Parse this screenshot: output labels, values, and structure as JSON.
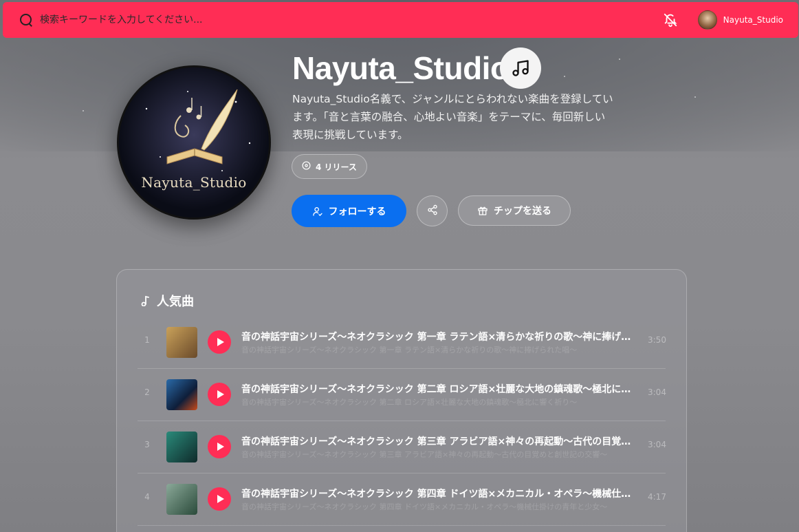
{
  "search": {
    "placeholder": "検索キーワードを入力してください..."
  },
  "user": {
    "name": "Nayuta_Studio"
  },
  "artist": {
    "name": "Nayuta_Studio",
    "avatar_caption": "Nayuta_Studio",
    "bio": "Nayuta_Studio名義で、ジャンルにとらわれない楽曲を登録しています。「音と言葉の融合、心地よい音楽」をテーマに、毎回新しい表現に挑戦しています。",
    "releases_label": "4 リリース"
  },
  "actions": {
    "follow_label": "フォローする",
    "tip_label": "チップを送る"
  },
  "popular": {
    "title": "人気曲",
    "tracks": [
      {
        "num": "1",
        "title": "音の神話宇宙シリーズ〜ネオクラシック 第一章 ラテン語×清らかな祈りの歌〜神に捧げられた唱〜",
        "subtitle": "音の神話宇宙シリーズ〜ネオクラシック 第一章 ラテン語×清らかな祈りの歌〜神に捧げられた唱〜",
        "duration": "3:50",
        "art": "#8a6a3a"
      },
      {
        "num": "2",
        "title": "音の神話宇宙シリーズ〜ネオクラシック 第二章 ロシア語×壮麗な大地の鎮魂歌〜極北に響く祈り〜",
        "subtitle": "音の神話宇宙シリーズ〜ネオクラシック 第二章 ロシア語×壮麗な大地の鎮魂歌〜極北に響く祈り〜",
        "duration": "3:04",
        "art": "#1f4a7a"
      },
      {
        "num": "3",
        "title": "音の神話宇宙シリーズ〜ネオクラシック 第三章 アラビア語×神々の再起動〜古代の目覚めと創世記の交響〜",
        "subtitle": "音の神話宇宙シリーズ〜ネオクラシック 第三章 アラビア語×神々の再起動〜古代の目覚めと創世記の交響〜",
        "duration": "3:04",
        "art": "#1f5a55"
      },
      {
        "num": "4",
        "title": "音の神話宇宙シリーズ〜ネオクラシック 第四章 ドイツ語×メカニカル・オペラ〜機械仕掛けの青年と少女〜",
        "subtitle": "音の神話宇宙シリーズ〜ネオクラシック 第四章 ドイツ語×メカニカル・オペラ〜機械仕掛けの青年と少女〜",
        "duration": "4:17",
        "art": "#4a6a5a"
      }
    ]
  },
  "colors": {
    "topbar": "#ff2d55",
    "follow": "#0a6ff0",
    "play": "#ff2d55"
  },
  "icons": [
    "search-icon",
    "bell-off-icon",
    "music-note-icon",
    "disc-icon",
    "user-check-icon",
    "share-icon",
    "gift-icon",
    "music-note-small-icon",
    "play-icon"
  ]
}
